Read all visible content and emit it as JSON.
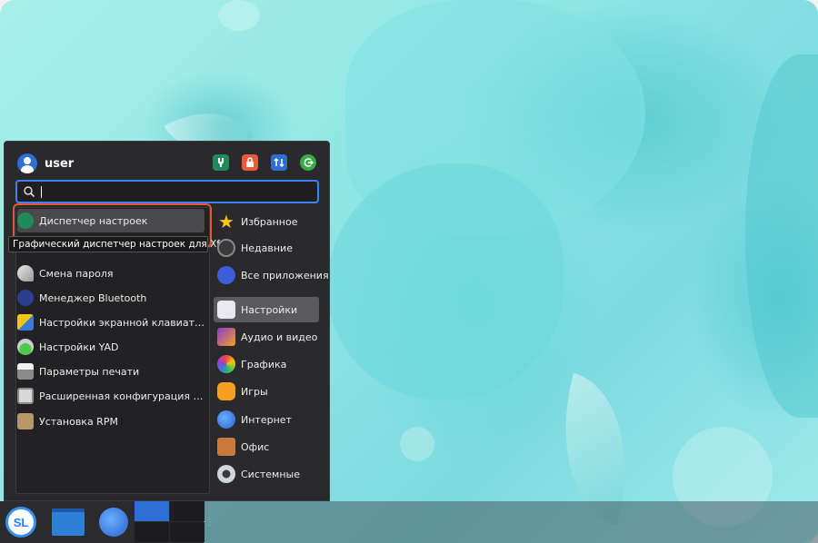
{
  "menu": {
    "username": "user",
    "search": {
      "value": "",
      "placeholder": ""
    },
    "tooltip": "Графический диспетчер настроек для Xfce",
    "apps": [
      {
        "label": "Диспетчер настроек",
        "icon": "settings-manager-icon",
        "selected": true
      },
      {
        "label": "Смена пароля",
        "icon": "key-icon",
        "selected": false
      },
      {
        "label": "Менеджер Bluetooth",
        "icon": "bluetooth-icon",
        "selected": false
      },
      {
        "label": "Настройки экранной клавиатуры...",
        "icon": "keyboard-icon",
        "selected": false
      },
      {
        "label": "Настройки YAD",
        "icon": "flask-icon",
        "selected": false
      },
      {
        "label": "Параметры печати",
        "icon": "printer-icon",
        "selected": false
      },
      {
        "label": "Расширенная конфигурация сети",
        "icon": "network-icon",
        "selected": false
      },
      {
        "label": "Установка RPM",
        "icon": "package-icon",
        "selected": false
      }
    ],
    "categories": [
      {
        "label": "Избранное",
        "icon": "star-icon"
      },
      {
        "label": "Недавние",
        "icon": "clock-icon"
      },
      {
        "label": "Все приложения",
        "icon": "apps-icon"
      },
      {
        "label": "Настройки",
        "icon": "settings-icon",
        "selected": true
      },
      {
        "label": "Аудио и видео",
        "icon": "media-icon"
      },
      {
        "label": "Графика",
        "icon": "graphics-icon"
      },
      {
        "label": "Игры",
        "icon": "gamepad-icon"
      },
      {
        "label": "Интернет",
        "icon": "internet-icon"
      },
      {
        "label": "Офис",
        "icon": "briefcase-icon"
      },
      {
        "label": "Системные",
        "icon": "system-icon"
      }
    ]
  },
  "taskbar": {
    "logo_text": "SL"
  },
  "colors": {
    "accent": "#3b82f6",
    "highlight": "#e8562a",
    "menu_bg": "#2a2a2c"
  }
}
